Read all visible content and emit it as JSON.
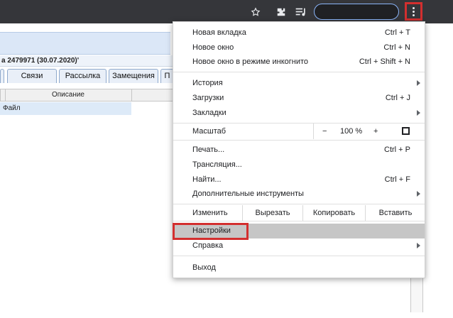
{
  "toolbar": {
    "icons": [
      "star-icon",
      "extensions-icon",
      "media-queue-icon",
      "profile-pill",
      "more-menu-icon"
    ]
  },
  "page": {
    "doc_title": "а 2479971 (30.07.2020)'",
    "tabs": [
      "Связи",
      "Рассылка",
      "Замещения",
      "П"
    ],
    "table_header": "Описание",
    "row_text": "Файл"
  },
  "menu": {
    "group1": [
      {
        "label": "Новая вкладка",
        "shortcut": "Ctrl + T"
      },
      {
        "label": "Новое окно",
        "shortcut": "Ctrl + N"
      },
      {
        "label": "Новое окно в режиме инкогнито",
        "shortcut": "Ctrl + Shift + N"
      }
    ],
    "group2": [
      {
        "label": "История",
        "shortcut": ""
      },
      {
        "label": "Загрузки",
        "shortcut": "Ctrl + J"
      },
      {
        "label": "Закладки",
        "shortcut": ""
      }
    ],
    "zoom": {
      "label": "Масштаб",
      "minus": "−",
      "value": "100 %",
      "plus": "+"
    },
    "group3": [
      {
        "label": "Печать...",
        "shortcut": "Ctrl + P"
      },
      {
        "label": "Трансляция...",
        "shortcut": ""
      },
      {
        "label": "Найти...",
        "shortcut": "Ctrl + F"
      },
      {
        "label": "Дополнительные инструменты",
        "shortcut": ""
      }
    ],
    "edit": {
      "label": "Изменить",
      "cut": "Вырезать",
      "copy": "Копировать",
      "paste": "Вставить"
    },
    "settings": "Настройки",
    "help": "Справка",
    "exit": "Выход"
  },
  "colors": {
    "highlight": "#d32f2f",
    "toolbar": "#35363a",
    "hover": "#c6c6c6"
  }
}
